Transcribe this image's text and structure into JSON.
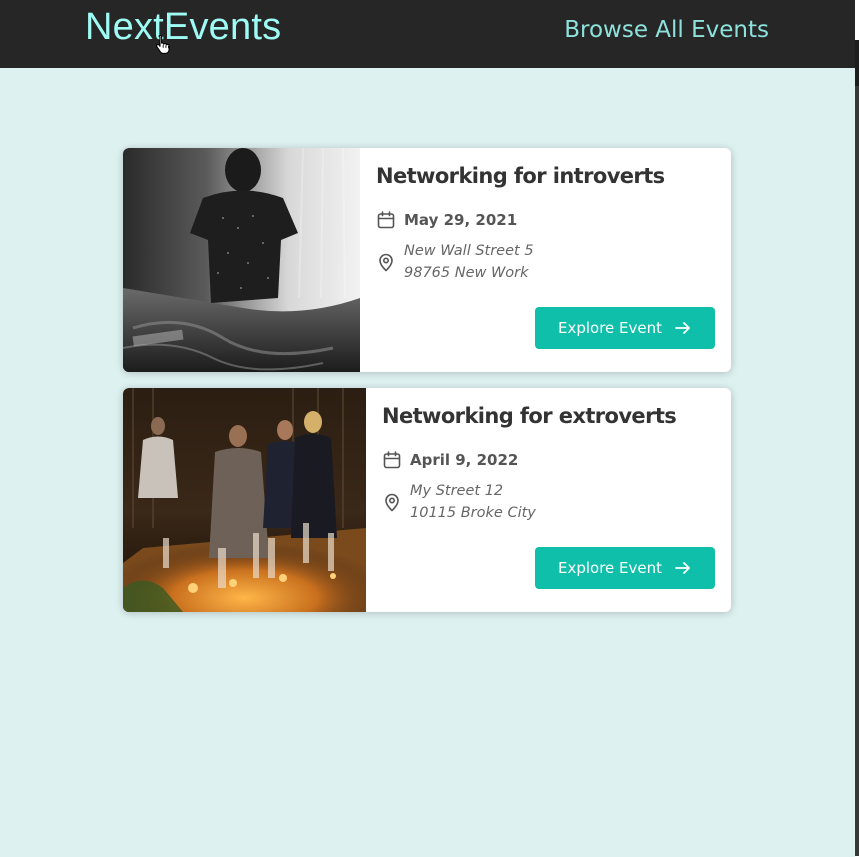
{
  "header": {
    "logo": "NextEvents",
    "nav_link": "Browse All Events"
  },
  "events": [
    {
      "title": "Networking for introverts",
      "date": "May 29, 2021",
      "address_line1": "New Wall Street 5",
      "address_line2": "98765 New Work",
      "button_label": "Explore Event",
      "image": "person-sitting-on-bed-bw-photo"
    },
    {
      "title": "Networking for extroverts",
      "date": "April 9, 2022",
      "address_line1": "My Street 12",
      "address_line2": "10115 Broke City",
      "button_label": "Explore Event",
      "image": "people-talking-at-party-photo"
    }
  ],
  "icons": {
    "date": "calendar-icon",
    "address": "map-pin-icon",
    "button": "arrow-right-icon",
    "cursor": "hand-pointer-icon"
  },
  "colors": {
    "page_background": "#ddf1f0",
    "header_background": "#262626",
    "logo": "#9efcf4",
    "nav_link": "#8ee2dc",
    "button": "#10bfa9"
  }
}
